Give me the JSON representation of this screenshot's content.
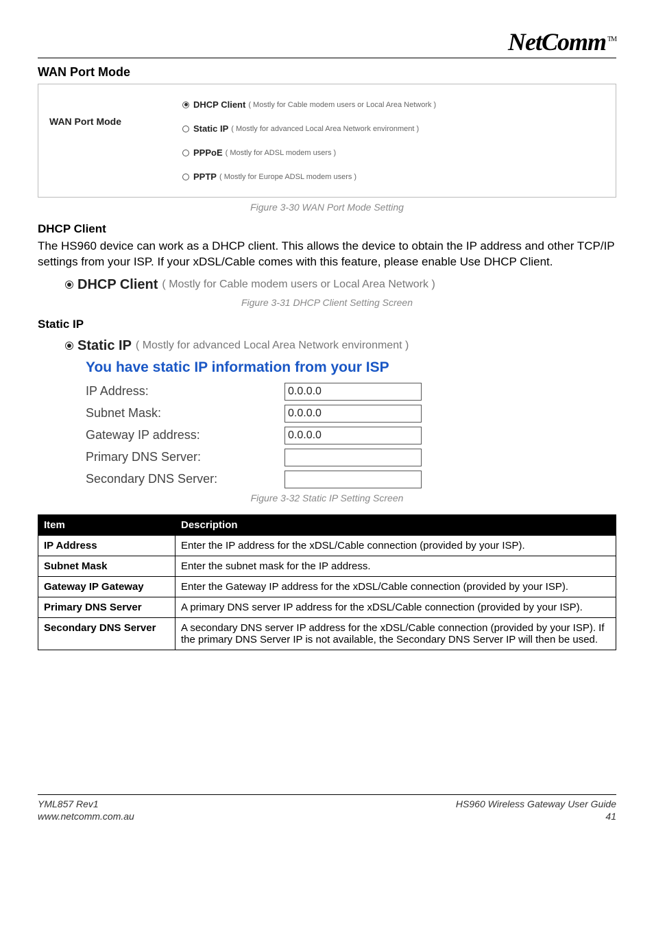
{
  "logo": {
    "text": "NetComm",
    "tm": "TM"
  },
  "sections": {
    "wan_heading": "WAN Port Mode",
    "wan_left_label": "WAN Port Mode",
    "wan_options": [
      {
        "label": "DHCP Client",
        "hint": "( Mostly for Cable modem users or Local Area Network )",
        "selected": true
      },
      {
        "label": "Static IP",
        "hint": "( Mostly for advanced Local Area Network environment )",
        "selected": false
      },
      {
        "label": "PPPoE",
        "hint": "( Mostly for ADSL modem users )",
        "selected": false
      },
      {
        "label": "PPTP",
        "hint": "( Mostly for Europe ADSL modem users )",
        "selected": false
      }
    ],
    "fig30": "Figure 3-30 WAN Port Mode Setting",
    "dhcp_heading": "DHCP Client",
    "dhcp_body": "The HS960 device can work as a DHCP client. This allows the device to obtain the IP address and other TCP/IP settings from your ISP. If your xDSL/Cable comes with this feature, please enable Use DHCP Client.",
    "dhcp_line": {
      "label": "DHCP Client",
      "hint": "( Mostly for Cable modem users or Local Area Network )"
    },
    "fig31": "Figure 3-31 DHCP Client Setting Screen",
    "staticip_heading": "Static IP",
    "static_line": {
      "label": "Static IP",
      "hint": "( Mostly for advanced Local Area Network environment )"
    },
    "static_title": "You have static IP information from your ISP",
    "static_fields": {
      "ip_label": "IP Address:",
      "ip_value": "0.0.0.0",
      "mask_label": "Subnet Mask:",
      "mask_value": "0.0.0.0",
      "gw_label": "Gateway IP address:",
      "gw_value": "0.0.0.0",
      "pdns_label": "Primary DNS Server:",
      "pdns_value": "",
      "sdns_label": "Secondary DNS Server:",
      "sdns_value": ""
    },
    "fig32": "Figure 3-32 Static IP Setting Screen",
    "table": {
      "h_item": "Item",
      "h_desc": "Description",
      "rows": [
        {
          "item": "IP Address",
          "desc": "Enter the IP address for the xDSL/Cable connection (provided by your ISP)."
        },
        {
          "item": "Subnet Mask",
          "desc": "Enter the subnet mask for the IP address."
        },
        {
          "item": "Gateway IP Gateway",
          "desc": "Enter the Gateway IP address for the xDSL/Cable connection (provided by your ISP)."
        },
        {
          "item": "Primary DNS Server",
          "desc": "A primary DNS server IP address for the xDSL/Cable connection (provided by your ISP)."
        },
        {
          "item": "Secondary DNS Server",
          "desc": "A secondary DNS server IP address for the xDSL/Cable connection (provided by your ISP). If the primary DNS Server IP is not available, the Secondary DNS Server IP will then be used."
        }
      ]
    }
  },
  "footer": {
    "left1": "YML857 Rev1",
    "left2": "www.netcomm.com.au",
    "right1": "HS960 Wireless Gateway User Guide",
    "right2": "41"
  }
}
